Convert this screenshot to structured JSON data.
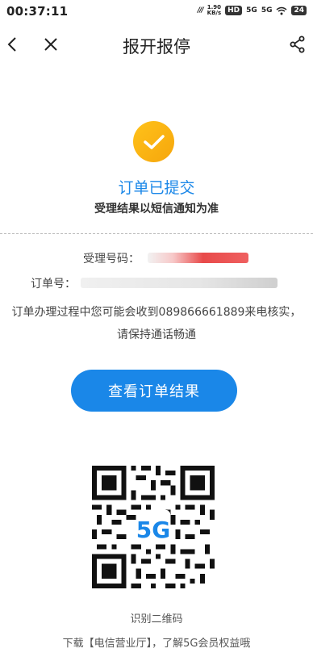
{
  "status_bar": {
    "time": "00:37:11",
    "speed": "1.90",
    "speed_unit": "KB/s",
    "hd": "HD",
    "net1": "5G",
    "net2": "5G",
    "battery": "24"
  },
  "nav": {
    "title": "报开报停",
    "back_icon": "chevron-left-icon",
    "close_icon": "close-icon",
    "share_icon": "share-icon"
  },
  "status": {
    "headline": "订单已提交",
    "subtext": "受理结果以短信通知为准",
    "accent_color": "#1a87e8",
    "check_color": "#f6b012"
  },
  "details": {
    "accept_label": "受理号码：",
    "order_label": "订单号：",
    "message": "订单办理过程中您可能会收到089866661889来电核实，请保持通话畅通"
  },
  "primary_button": {
    "label": "查看订单结果"
  },
  "qr": {
    "badge": "5G",
    "caption": "识别二维码",
    "download_text": "下载【电信营业厅】，了解5G会员权益哦"
  }
}
